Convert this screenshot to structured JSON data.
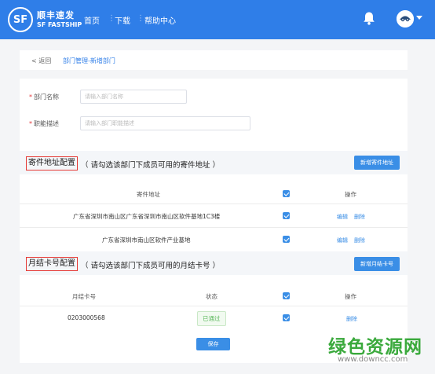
{
  "header": {
    "logo_mark": "SF",
    "logo_cn": "顺丰速发",
    "logo_en": "SF FASTSHIP",
    "nav": [
      "首页",
      "下载",
      "帮助中心"
    ],
    "icons": [
      "bell-icon",
      "avatar",
      "chevron-down-icon"
    ]
  },
  "breadcrumb": {
    "back": "< 返回",
    "path": "部门管理-新增部门"
  },
  "form": {
    "name_label": "部门名称",
    "name_placeholder": "请输入部门名称",
    "desc_label": "职能描述",
    "desc_placeholder": "请输入部门职能描述"
  },
  "address_section": {
    "title": "寄件地址配置",
    "note": "（ 请勾选该部门下成员可用的寄件地址 ）",
    "add_button": "新增寄件地址",
    "columns": [
      "寄件地址",
      "操作"
    ],
    "rows": [
      {
        "address": "广东省深圳市南山区广东省深圳市南山区软件基地1C3楼",
        "edit": "编辑",
        "delete": "删除"
      },
      {
        "address": "广东省深圳市南山区软件产业基地",
        "edit": "编辑",
        "delete": "删除"
      }
    ]
  },
  "card_section": {
    "title": "月结卡号配置",
    "note": "（ 请勾选该部门下成员可用的月结卡号 ）",
    "add_button": "新增月结卡号",
    "columns": [
      "月结卡号",
      "状态",
      "操作"
    ],
    "rows": [
      {
        "card": "0203000568",
        "status": "已通过",
        "delete": "删除"
      }
    ]
  },
  "save_button": "保存",
  "watermark": {
    "cn": "绿色资源网",
    "url": "www.downcc.com"
  },
  "colors": {
    "header_blue": "#2f7ee8",
    "accent_blue": "#3a8ee6",
    "required_red": "#e4393c",
    "highlight_red": "#e53935",
    "status_green": "#5cb85c",
    "watermark_green": "#3aa93c"
  }
}
